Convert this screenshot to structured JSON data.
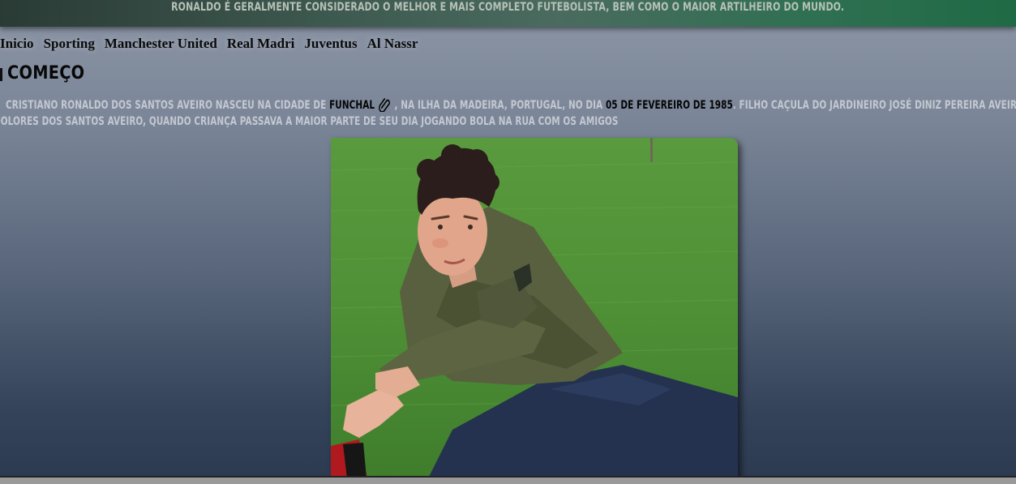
{
  "banner": {
    "text": "RONALDO É GERALMENTE CONSIDERADO O MELHOR E MAIS COMPLETO FUTEBOLISTA, BEM COMO O MAIOR ARTILHEIRO DO MUNDO."
  },
  "nav": {
    "items": [
      {
        "label": "Inicio"
      },
      {
        "label": "Sporting"
      },
      {
        "label": "Manchester United"
      },
      {
        "label": "Real Madri"
      },
      {
        "label": "Juventus"
      },
      {
        "label": "Al Nassr"
      }
    ]
  },
  "section": {
    "title": "COMEÇO",
    "paragraph": {
      "part1": "CRISTIANO RONALDO DOS SANTOS AVEIRO NASCEU NA CIDADE DE",
      "city": "FUNCHAL",
      "part2": ", NA ILHA DA MADEIRA, PORTUGAL, NO DIA",
      "date": "05 DE FEVEREIRO DE 1985",
      "part3": ". FILHO CAÇULA DO JARDINEIRO JOSÉ DINIZ PEREIRA AVEIRO E DA COZINHEIRA MARIA",
      "line2": "DOLORES DOS SANTOS AVEIRO, QUANDO CRIANÇA PASSAVA A MAIOR PARTE DE SEU DIA JOGANDO BOLA NA RUA COM OS AMIGOS"
    },
    "link_icon": "paperclip-icon",
    "photo_subject": "young Cristiano Ronaldo stretching on grass"
  },
  "colors": {
    "banner_start": "#2a3b35",
    "banner_end": "#1f6a45",
    "body_top": "#8c96a6",
    "body_bottom": "#2c3a50",
    "paragraph_text": "#c3c8d1",
    "highlight_text": "#050505"
  }
}
